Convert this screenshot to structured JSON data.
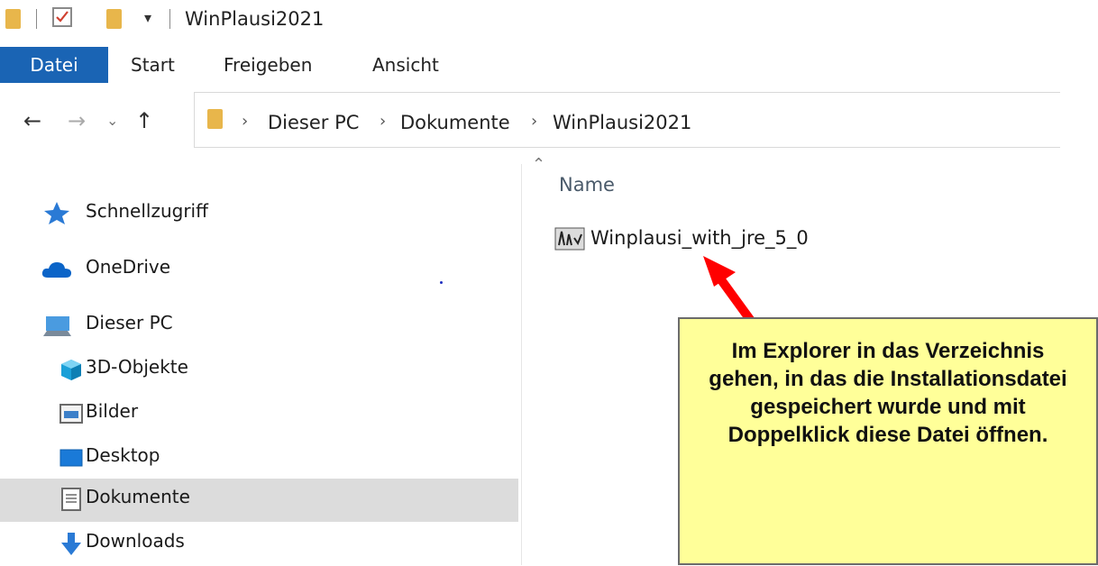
{
  "window": {
    "title": "WinPlausi2021"
  },
  "ribbon": {
    "tabs": [
      "Datei",
      "Start",
      "Freigeben",
      "Ansicht"
    ]
  },
  "address": {
    "crumbs": [
      "Dieser PC",
      "Dokumente",
      "WinPlausi2021"
    ]
  },
  "nav": {
    "items": [
      {
        "label": "Schnellzugriff",
        "icon": "star-icon"
      },
      {
        "label": "OneDrive",
        "icon": "cloud-icon"
      },
      {
        "label": "Dieser PC",
        "icon": "computer-icon"
      },
      {
        "label": "3D-Objekte",
        "icon": "cube-icon"
      },
      {
        "label": "Bilder",
        "icon": "pictures-icon"
      },
      {
        "label": "Desktop",
        "icon": "desktop-icon"
      },
      {
        "label": "Dokumente",
        "icon": "document-icon",
        "selected": true
      },
      {
        "label": "Downloads",
        "icon": "download-icon"
      }
    ]
  },
  "filelist": {
    "column_name": "Name",
    "files": [
      {
        "name": "Winplausi_with_jre_5_0",
        "icon": "installer-icon"
      }
    ]
  },
  "callout": {
    "text": "Im Explorer in das Verzeichnis gehen, in das die Installationsdatei gespeichert wurde und mit Doppelklick diese Datei öffnen."
  },
  "colors": {
    "accent": "#1a64b4",
    "callout_bg": "#ffff99",
    "arrow": "#ff0000"
  }
}
